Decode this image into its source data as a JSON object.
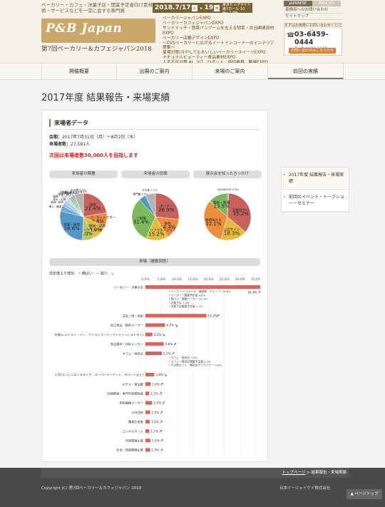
{
  "header": {
    "tagline": "ベーカリー・カフェ・洋菓子店・開業予定者向け素材・技術・サービスなどを一堂に会する専門展",
    "logo": "P&B Japan",
    "subtitle": "第7回ベーカリー＆カフェジャパン2018",
    "date_start": "2018.7/17",
    "day_start": "火",
    "date_end": "19",
    "day_end": "木",
    "venue": "東京ビッグサイト 東7ホール 10時〜17時",
    "expos": [
      "ベーカリージャパンEXPO",
      "ベーカリーカフェジャパンEXPO",
      "サンドイッチ・惣菜パンブームを支える惣菜・弁当関連資材EXPO",
      "ベーカリー店舗デザインEXPO",
      "〜CVSベーカリーに広がるイートインコーナーのインテリア提案〜",
      "夏場対策(冷やしてもおいしいベーカリースイーツEXPO",
      "ナチュラルビューティー食品素材EXPO",
      "人手不足対策 AI、IoT、ロボット、時短機器、関連EXPO"
    ],
    "lang_jp": "JAPANESE",
    "lang_en": "ENGLISH",
    "top_links": [
      "事務局へのお問い合わせ",
      "サイトマップ"
    ],
    "contact_head": "まずはお気軽にお問い合わせください。",
    "tel": "03-6459-0444",
    "hours": "月〜金 10:00〜17:00",
    "inquiry_button": "お問い合わせはこちらから"
  },
  "nav": [
    "開催概要",
    "出展のご案内",
    "来場のご案内",
    "前回の実績"
  ],
  "page_title": "2017年度 結果報告・来場実績",
  "section_title": "来場者データ",
  "info": {
    "period_label": "会期：",
    "period": "2017年7月31日（月）〜8月2日（水）",
    "count_label": "来場者数：",
    "count": "27,581人"
  },
  "goal": "次回は来場者数30,000人を目指します",
  "pies": [
    {
      "title": "来場者の職種",
      "slices": [
        {
          "label": "経営",
          "value": 22.4,
          "color": "#c7615b"
        },
        {
          "label": "ショップ・ディレクター",
          "value": 9.8,
          "color": "#ed8e3e"
        },
        {
          "label": "商品開発・研究",
          "value": 10.9,
          "color": "#e5bd3e"
        },
        {
          "label": "企画・マーケティング",
          "value": 8.0,
          "color": "#b7cb5a"
        },
        {
          "label": "営業・販売",
          "value": 28.6,
          "color": "#5598c7"
        },
        {
          "label": "購入・調達",
          "value": 3.7,
          "color": "#6aa6d6"
        },
        {
          "label": "製造・技術",
          "value": 2.3,
          "color": "#8fbde0"
        },
        {
          "label": "宣伝・広報",
          "value": 2.3,
          "color": "#a9cbe7"
        },
        {
          "label": "総務・サービス",
          "value": 2.3,
          "color": "#c2d9ee"
        },
        {
          "label": "調理・操作",
          "value": 1.7,
          "color": "#9cc9a4"
        },
        {
          "label": "店舗管理",
          "value": 1.3,
          "color": "#88b88a"
        },
        {
          "label": "広報・宣伝",
          "value": 1.1,
          "color": "#74a978"
        },
        {
          "label": "スーパーバイザー",
          "value": 0.4,
          "color": "#6a9b6c"
        },
        {
          "label": "その他",
          "value": 6.2,
          "color": "#b4b4b4"
        }
      ]
    },
    {
      "title": "来場者の役職",
      "slices": [
        {
          "label": "オーナー",
          "value": 26.9,
          "color": "#c7615b"
        },
        {
          "label": "部長",
          "value": 14.4,
          "color": "#ed8e3e"
        },
        {
          "label": "課長・エリアマネージャー",
          "value": 15.2,
          "color": "#e5bd3e"
        },
        {
          "label": "一般職",
          "value": 31.4,
          "color": "#7cb95a"
        },
        {
          "label": "専門職",
          "value": 5.0,
          "color": "#5598c7"
        },
        {
          "label": "その他",
          "value": 7.1,
          "color": "#b4b4b4"
        }
      ]
    },
    {
      "title": "展示会を知ったきっかけ",
      "slices": [
        {
          "label": "FACEBOOK",
          "value": 0.9,
          "color": "#5598c7"
        },
        {
          "label": "出展社から",
          "value": 35.2,
          "color": "#c7615b"
        },
        {
          "label": "公式サイト",
          "value": 18.3,
          "color": "#e5bd3e"
        },
        {
          "label": "事務局から",
          "value": 32.1,
          "color": "#ed8e3e"
        },
        {
          "label": "雑誌・新聞",
          "value": 13.5,
          "color": "#7cb95a"
        }
      ]
    }
  ],
  "bar_title": "来場（複数回答）",
  "bar_legend": {
    "up": "前年度より増加：",
    "down": "横ばい：",
    "minus": "減少："
  },
  "chart_data": {
    "type": "bar",
    "title": "来場（複数回答）",
    "xlim": [
      0,
      35
    ],
    "xticks": [
      "0.0%",
      "5.0%",
      "10.0%",
      "15.0%",
      "20.0%",
      "25.0%",
      "30.0%",
      "35.0%"
    ],
    "categories": [
      "ベーカリー・洋菓子店",
      "总社・部・供給",
      "加工食品・飲料メーカー",
      "外食(レストラン・バー、ファストフード・ファミリーレストラン)",
      "食品素材・材料メーカー",
      "カフェ・喫茶店",
      "小売(コンビニエンスストア、スーパーマーケット、デパートなど)",
      "ホテル・宿泊業",
      "料理教室・専門学校関係者",
      "厨房機器メーカー",
      "公共団体",
      "農業生産者",
      "コンサルタント",
      "包装関連企業",
      "弁当・惣菜関連企業",
      "メディア",
      "その他"
    ],
    "values": [
      36.4,
      19.3,
      6.2,
      2.2,
      5.8,
      5.2,
      2.8,
      1.6,
      1.2,
      2.1,
      1.5,
      1.4,
      1.2,
      1.6,
      1.5,
      0.9,
      6.5
    ],
    "value_labels": [
      "36.4%",
      "19.3%",
      "6.2%",
      "2.2%",
      "5.8%",
      "5.2%",
      "2.8%",
      "1.6%",
      "1.2%",
      "2.1%",
      "1.5%",
      "1.4%",
      "1.2%",
      "1.6%",
      "1.5%",
      "0.9%",
      "6.5%"
    ],
    "trend": [
      "up",
      "up",
      "down",
      "down",
      "up",
      "up",
      "down",
      "up",
      "up",
      "up",
      "up",
      "up",
      "up",
      "up",
      "up",
      "up",
      "up"
    ],
    "sub_breakdowns": [
      {
        "parent": "ベーカリー・洋菓子店",
        "items": [
          "ベーカリー(リテール・業務卸、チェーン) 14.8%",
          "ベーカリー開業予定者 4.8%",
          "製パン・製菓メーカー 10.1%",
          "洋菓子店 7.4%",
          "洋菓子店開業予定者 1.7%"
        ]
      },
      {
        "parent": "カフェ・喫茶店",
        "items": [
          "カフェ・喫茶店 2.9%",
          "カフェ・喫茶店開業予定者 2.5%",
          "その他カフェ・喫茶店サプライヤー 0.8%"
        ]
      }
    ],
    "bar_color": "#d9645c",
    "up_color": "#d03020",
    "down_color": "#2060a0"
  },
  "sidebar": [
    "2017年度 結果報告・来場実績",
    "前回のイベント・トークショー・セミナー"
  ],
  "footer": {
    "breadcrumb_top": "トップページ",
    "breadcrumb_current": "結果報告・来場実績",
    "copyright": "Copyright (C) 第7回ベーカリー＆カフェジャパン 2018",
    "company": "日本イージェイケイ株式会社",
    "pagetop": "ページトップ"
  }
}
